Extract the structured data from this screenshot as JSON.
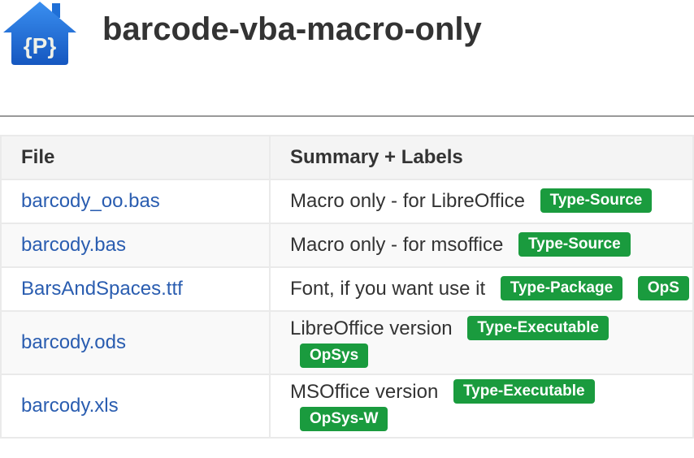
{
  "project": {
    "title": "barcode-vba-macro-only",
    "logo_text": "{P}"
  },
  "table": {
    "headers": [
      "File",
      "Summary + Labels"
    ],
    "rows": [
      {
        "file": "barcody_oo.bas",
        "summary": "Macro only - for LibreOffice",
        "labels": [
          "Type-Source"
        ]
      },
      {
        "file": "barcody.bas",
        "summary": "Macro only - for msoffice",
        "labels": [
          "Type-Source"
        ]
      },
      {
        "file": "BarsAndSpaces.ttf",
        "summary": "Font, if you want use it",
        "labels": [
          "Type-Package",
          "OpS"
        ]
      },
      {
        "file": "barcody.ods",
        "summary": "LibreOffice version",
        "labels": [
          "Type-Executable",
          "OpSys"
        ]
      },
      {
        "file": "barcody.xls",
        "summary": "MSOffice version",
        "labels": [
          "Type-Executable",
          "OpSys-W"
        ]
      }
    ]
  },
  "colors": {
    "label_bg": "#1a9b3e",
    "link": "#2a5db0",
    "logo": "#1f6fd6"
  }
}
